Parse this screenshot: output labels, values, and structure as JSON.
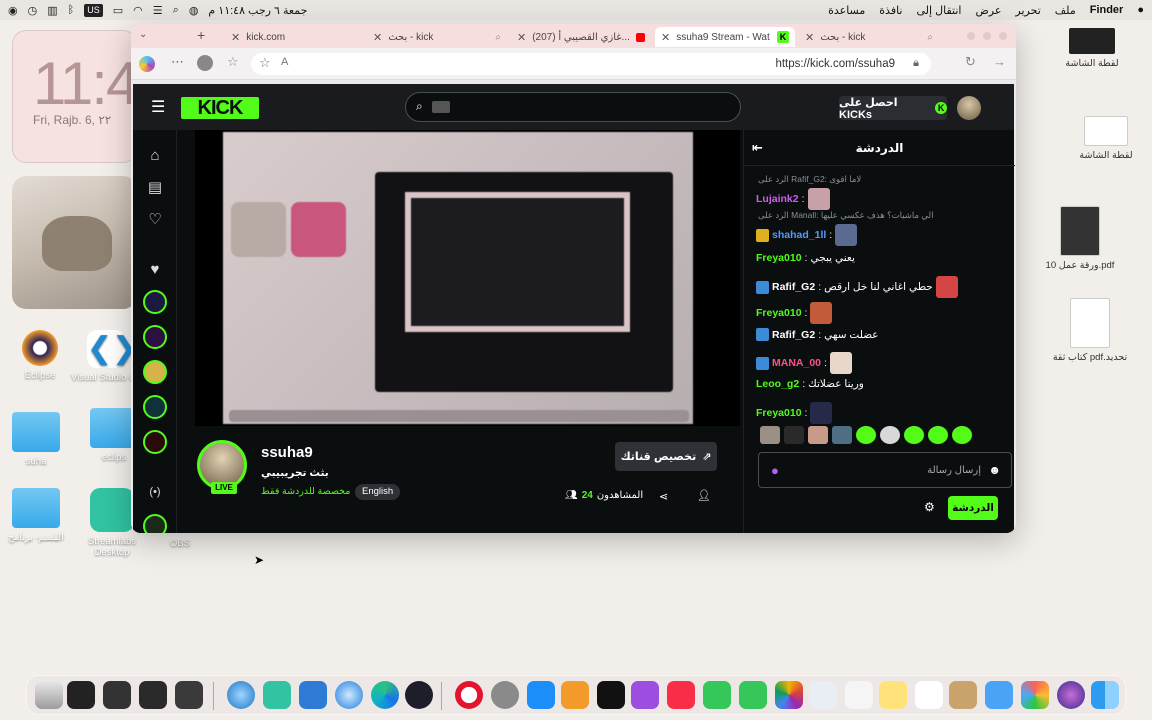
{
  "menubar": {
    "left_items": [
      "جمعة ٦ رجب ١١:٤٨ م"
    ],
    "right_items": [
      "Finder",
      "ملف",
      "تحرير",
      "عرض",
      "انتقال إلى",
      "نافذة",
      "مساعدة"
    ],
    "us_label": "US"
  },
  "widgets": {
    "clock_time": "11:4",
    "clock_date": "Fri, Rajb. 6, ٢٢"
  },
  "desktop_icons": {
    "eclipse": "Eclipse",
    "vscode": "Visual Studio Co",
    "suha": "suha",
    "eclips": "eclips",
    "folder2": "القسم- برنامج",
    "streamlabs": "Streamlabs Desktop",
    "obs": "OBS",
    "file1": "لقطة الشاشة",
    "file2": "لقطة الشاشة",
    "pdf1": "ورقة عمل 10.pdf",
    "pdf2": "كتاب ثقة pdf.تحديد"
  },
  "browser": {
    "tabs": [
      {
        "title": "kick.com",
        "icon": "close"
      },
      {
        "title": "بحث - kick",
        "icon": "search"
      },
      {
        "title": "(207) غازي القصيبي أ...",
        "icon": "youtube"
      },
      {
        "title": "ssuha9 Stream - Wat",
        "icon": "kick",
        "active": true
      },
      {
        "title": "بحث - kick",
        "icon": "search"
      }
    ],
    "url": "https://kick.com/ssuha9"
  },
  "kick": {
    "logo": "KICK",
    "get_kicks": "احصل على KICKs",
    "streamer_name": "ssuha9",
    "stream_title": "بثث تجريبيبي",
    "category": "مخصصة للدردشة فقط",
    "language": "English",
    "live": "LIVE",
    "customize": "تخصيص قناتك",
    "viewers_label": "المشاهدون",
    "viewers_count": "24"
  },
  "chat": {
    "title": "الدردشة",
    "messages": [
      {
        "type": "reply",
        "text": "الرد على Rafif_G2: لاما اقوى"
      },
      {
        "user": "Lujaink2",
        "color": "#d05cf0",
        "text": ""
      },
      {
        "type": "reply",
        "text": "الرد على Manall: الي ماشيات؟ هذف عكسي عليها"
      },
      {
        "user": "shahad_1ll",
        "color": "#4f9bff",
        "text": ""
      },
      {
        "user": "Freya010",
        "color": "#53fc18",
        "text": "يعني يبجي"
      },
      {
        "user": "Rafif_G2",
        "color": "#fff",
        "text": "حطي اغاني لنا خل ارقص"
      },
      {
        "user": "Freya010",
        "color": "#53fc18",
        "text": ""
      },
      {
        "user": "Rafif_G2",
        "color": "#fff",
        "text": "عضلت سهي"
      },
      {
        "user": "MANA_00",
        "color": "#ff4f8b",
        "text": ""
      },
      {
        "user": "Leoo_g2",
        "color": "#53fc18",
        "text": "ورينا عضلاتك"
      },
      {
        "user": "Freya010",
        "color": "#53fc18",
        "text": ""
      }
    ],
    "input_placeholder": "إرسال رسالة",
    "send_button": "الدردشة"
  }
}
